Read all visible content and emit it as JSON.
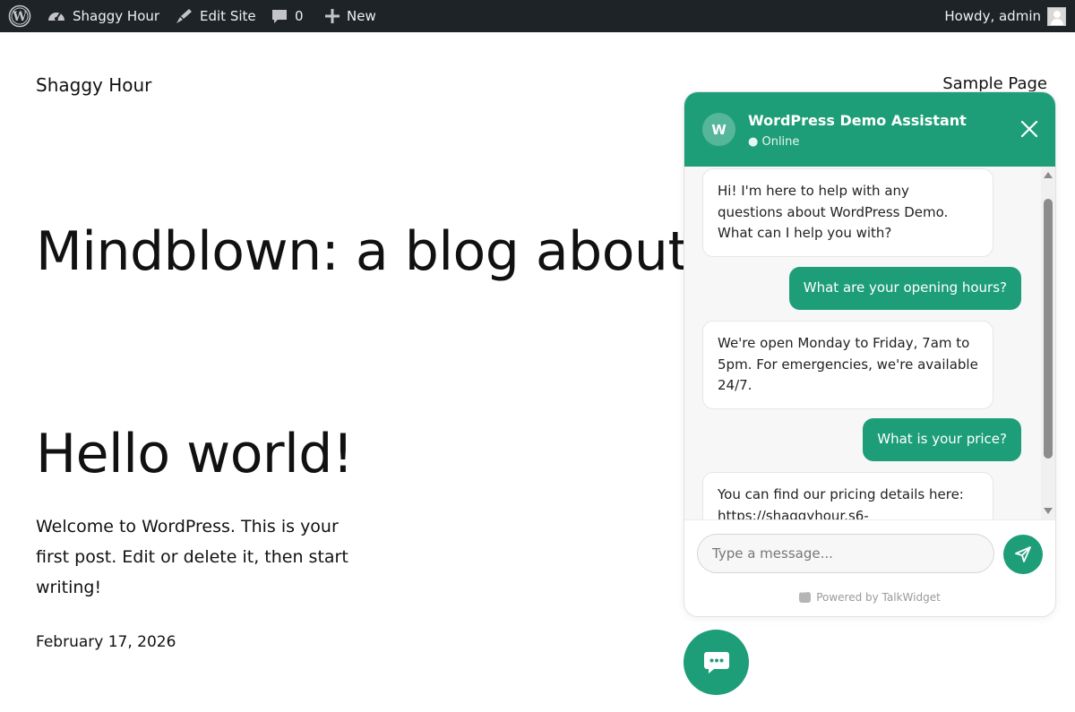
{
  "admin_bar": {
    "site_name": "Shaggy Hour",
    "edit_site": "Edit Site",
    "comments_count": "0",
    "new_label": "New",
    "greeting": "Howdy, admin"
  },
  "header": {
    "site_title": "Shaggy Hour",
    "nav_link": "Sample Page"
  },
  "main": {
    "tagline": "Mindblown: a blog about",
    "post": {
      "title": "Hello world!",
      "excerpt": "Welcome to WordPress. This is your first post. Edit or delete it, then start writing!",
      "date": "February 17, 2026"
    }
  },
  "chat": {
    "avatar_letter": "W",
    "title": "WordPress Demo Assistant",
    "status": "● Online",
    "messages": [
      {
        "role": "bot",
        "text": "Hi! I'm here to help with any questions about WordPress Demo. What can I help you with?"
      },
      {
        "role": "user",
        "text": "What are your opening hours?"
      },
      {
        "role": "bot",
        "text": "We're open Monday to Friday, 7am to 5pm. For emergencies, we're available 24/7."
      },
      {
        "role": "user",
        "text": "What is your price?"
      },
      {
        "role": "bot",
        "text": "You can find our pricing details here: https://shaggyhour.s6-"
      }
    ],
    "input_placeholder": "Type a message...",
    "powered_by": "Powered by TalkWidget"
  },
  "colors": {
    "admin_bar_bg": "#1d2327",
    "accent": "#1e9e78"
  },
  "icons": [
    "wordpress-logo-icon",
    "dashboard-icon",
    "edit-brush-icon",
    "comment-icon",
    "plus-icon",
    "user-avatar-icon",
    "close-icon",
    "send-icon",
    "chat-bubble-icon"
  ]
}
